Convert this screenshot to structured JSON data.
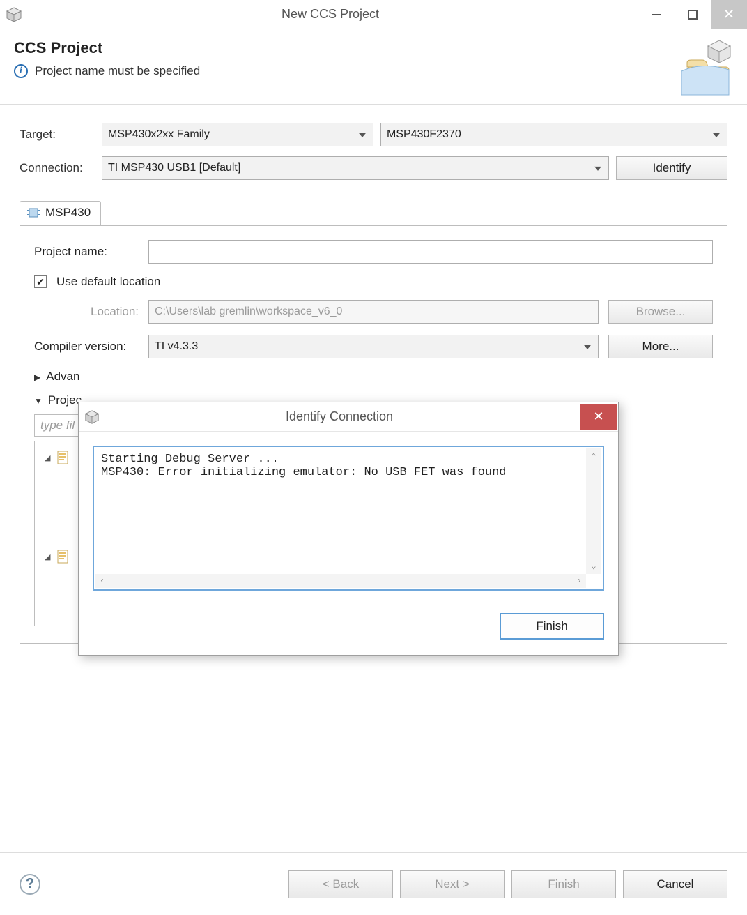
{
  "window": {
    "title": "New CCS Project"
  },
  "banner": {
    "heading": "CCS Project",
    "message": "Project name must be specified"
  },
  "target": {
    "label": "Target:",
    "family": "MSP430x2xx Family",
    "device": "MSP430F2370"
  },
  "connection": {
    "label": "Connection:",
    "value": "TI MSP430 USB1 [Default]",
    "identify": "Identify"
  },
  "tab": {
    "label": "MSP430"
  },
  "project_name": {
    "label": "Project name:",
    "value": ""
  },
  "default_loc": {
    "checked": true,
    "label": "Use default location"
  },
  "location": {
    "label": "Location:",
    "value": "C:\\Users\\lab gremlin\\workspace_v6_0",
    "browse": "Browse..."
  },
  "compiler": {
    "label": "Compiler version:",
    "value": "TI v4.3.3",
    "more": "More..."
  },
  "advanced": {
    "label": "Advan"
  },
  "projects": {
    "label": "Projec"
  },
  "filter": {
    "placeholder": "type fil"
  },
  "footer": {
    "back": "< Back",
    "next": "Next >",
    "finish": "Finish",
    "cancel": "Cancel"
  },
  "dialog": {
    "title": "Identify Connection",
    "console": "Starting Debug Server ...\nMSP430: Error initializing emulator: No USB FET was found",
    "finish": "Finish"
  }
}
